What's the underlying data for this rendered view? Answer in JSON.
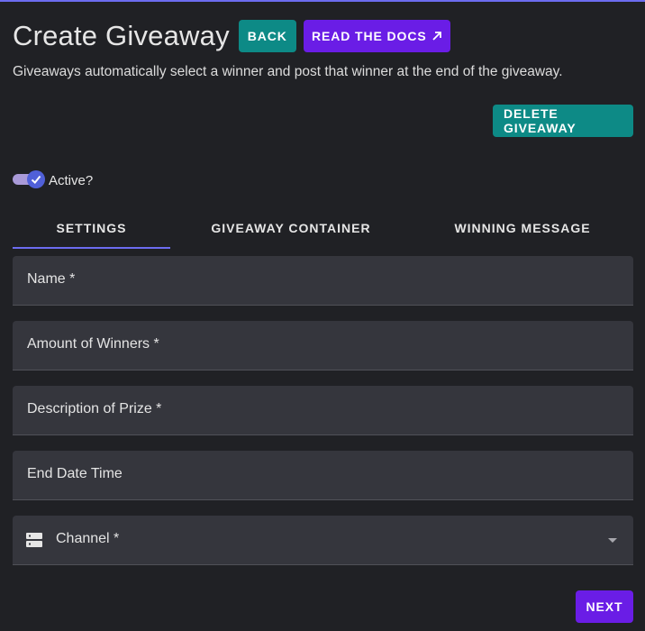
{
  "header": {
    "title": "Create Giveaway",
    "back_label": "Back",
    "docs_label": "Read the docs",
    "docs_icon": "external-link-icon"
  },
  "subtitle": "Giveaways automatically select a winner and post that winner at the end of the giveaway.",
  "actions": {
    "delete_label": "Delete Giveaway",
    "next_label": "Next"
  },
  "toggle": {
    "label": "Active?",
    "checked": true
  },
  "tabs": [
    {
      "label": "Settings",
      "active": true
    },
    {
      "label": "Giveaway Container",
      "active": false
    },
    {
      "label": "Winning Message",
      "active": false
    }
  ],
  "fields": {
    "name": "Name *",
    "winners": "Amount of Winners *",
    "prize": "Description of Prize *",
    "end_date": "End Date Time",
    "channel": "Channel *",
    "channel_icon": "server-icon",
    "channel_caret": "chevron-down-icon"
  },
  "colors": {
    "background": "#202125",
    "field": "#35363d",
    "teal": "#0d8a86",
    "purple": "#6a1de6",
    "accent": "#6c6cf0"
  }
}
